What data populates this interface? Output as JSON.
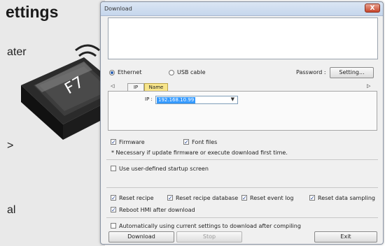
{
  "slide": {
    "title": "ettings",
    "fragments": [
      "ater",
      ">",
      "al"
    ],
    "key_label": "F7"
  },
  "dialog": {
    "title": "Download",
    "close_label": "X",
    "connection": {
      "ethernet_label": "Ethernet",
      "usb_label": "USB cable",
      "selected": "Ethernet",
      "password_label": "Password :",
      "setting_button": "Setting..."
    },
    "tabs": [
      {
        "label": "IP",
        "active": false
      },
      {
        "label": "Name",
        "active": true
      }
    ],
    "tab_right_arrow": "▷",
    "tab_left_arrow": "◁",
    "ip": {
      "label": "IP :",
      "value": "192.168.10.99"
    },
    "options": {
      "firmware": {
        "label": "Firmware",
        "checked": true
      },
      "font_files": {
        "label": "Font files",
        "checked": true
      },
      "note": "* Necessary if update firmware or execute download first time.",
      "startup_screen": {
        "label": "Use user-defined startup screen",
        "checked": false
      }
    },
    "resets": [
      {
        "label": "Reset recipe",
        "checked": true
      },
      {
        "label": "Reset recipe database",
        "checked": true
      },
      {
        "label": "Reset event log",
        "checked": true
      },
      {
        "label": "Reset data sampling",
        "checked": true
      }
    ],
    "reboot": {
      "label": "Reboot HMI after download",
      "checked": true
    },
    "auto_download": {
      "label": "Automatically using current settings to download after compiling",
      "checked": false
    },
    "buttons": {
      "download": "Download",
      "stop": "Stop",
      "exit": "Exit"
    }
  }
}
